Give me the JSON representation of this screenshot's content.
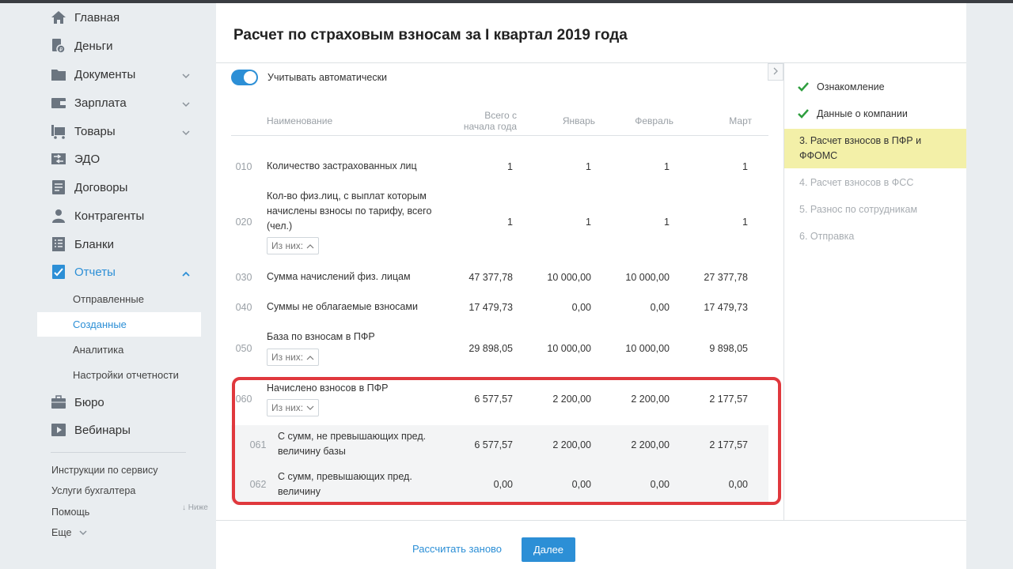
{
  "sidebar": {
    "items": [
      {
        "label": "Главная",
        "icon": "home-icon"
      },
      {
        "label": "Деньги",
        "icon": "money-icon"
      },
      {
        "label": "Документы",
        "icon": "folder-icon"
      },
      {
        "label": "Зарплата",
        "icon": "wallet-icon"
      },
      {
        "label": "Товары",
        "icon": "cart-icon"
      },
      {
        "label": "ЭДО",
        "icon": "edo-icon"
      },
      {
        "label": "Договоры",
        "icon": "contract-icon"
      },
      {
        "label": "Контрагенты",
        "icon": "people-icon"
      },
      {
        "label": "Бланки",
        "icon": "forms-icon"
      },
      {
        "label": "Отчеты",
        "icon": "report-icon"
      },
      {
        "label": "Бюро",
        "icon": "briefcase-icon"
      },
      {
        "label": "Вебинары",
        "icon": "webinar-icon"
      }
    ],
    "reports_sub": [
      "Отправленные",
      "Созданные",
      "Аналитика",
      "Настройки отчетности"
    ],
    "footer_links": [
      "Инструкции по сервису",
      "Услуги бухгалтера",
      "Помощь",
      "Еще"
    ],
    "below_hint": "Ниже"
  },
  "card": {
    "title": "Расчет по страховым взносам за I квартал 2019 года",
    "toggle_label": "Учитывать автоматически",
    "toggle_on": true,
    "columns": {
      "name": "Наименование",
      "total_line1": "Всего с",
      "total_line2": "начала года",
      "jan": "Январь",
      "feb": "Февраль",
      "mar": "Март"
    },
    "iz_nih": "Из них:",
    "rows": [
      {
        "code": "010",
        "name": "Количество застрахованных лиц",
        "vals": [
          "1",
          "1",
          "1",
          "1"
        ]
      },
      {
        "code": "020",
        "name": "Кол-во физ.лиц, с выплат которым начислены взносы по тарифу, всего (чел.)",
        "vals": [
          "1",
          "1",
          "1",
          "1"
        ]
      },
      {
        "code": "030",
        "name": "Сумма начислений физ. лицам",
        "vals": [
          "47 377,78",
          "10 000,00",
          "10 000,00",
          "27 377,78"
        ]
      },
      {
        "code": "040",
        "name": "Суммы не облагаемые взносами",
        "vals": [
          "17 479,73",
          "0,00",
          "0,00",
          "17 479,73"
        ]
      },
      {
        "code": "050",
        "name": "База по взносам в ПФР",
        "vals": [
          "29 898,05",
          "10 000,00",
          "10 000,00",
          "9 898,05"
        ]
      },
      {
        "code": "060",
        "name": "Начислено взносов в ПФР",
        "vals": [
          "6 577,57",
          "2 200,00",
          "2 200,00",
          "2 177,57"
        ]
      },
      {
        "code": "061",
        "name": "С сумм, не превышающих пред. величину базы",
        "vals": [
          "6 577,57",
          "2 200,00",
          "2 200,00",
          "2 177,57"
        ]
      },
      {
        "code": "062",
        "name": "С сумм, превышающих пред. величину",
        "vals": [
          "0,00",
          "0,00",
          "0,00",
          "0,00"
        ]
      }
    ],
    "steps": [
      {
        "label": "Ознакомление",
        "state": "done"
      },
      {
        "label": "Данные о компании",
        "state": "done"
      },
      {
        "label": "3.  Расчет взносов в ПФР и ФФОМС",
        "state": "current"
      },
      {
        "label": "4.  Расчет взносов в ФСС",
        "state": "todo"
      },
      {
        "label": "5.  Разнос по сотрудникам",
        "state": "todo"
      },
      {
        "label": "6.  Отправка",
        "state": "todo"
      }
    ],
    "recalc_label": "Рассчитать заново",
    "next_label": "Далее"
  },
  "colors": {
    "accent": "#2c8fd6",
    "current_step": "#f3f0a8",
    "highlight": "#e0383d",
    "check": "#2e9e3e"
  }
}
